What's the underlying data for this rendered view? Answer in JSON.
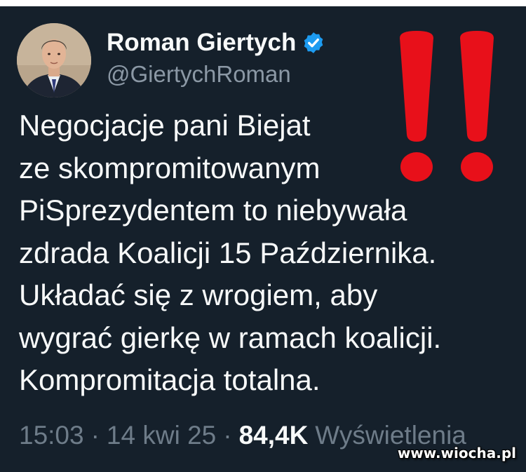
{
  "author": {
    "display_name": "Roman Giertych",
    "handle": "@GiertychRoman",
    "verified": true
  },
  "tweet": {
    "lines": [
      "Negocjacje pani Biejat",
      "ze skompromitowanym",
      "PiSprezydentem to niebywała",
      "zdrada Koalicji 15 Października.",
      "Układać się z wrogiem, aby",
      "wygrać gierkę w ramach koalicji.",
      "Kompromitacja totalna."
    ]
  },
  "meta": {
    "time": "15:03",
    "separator": "·",
    "date": "14 kwi 25",
    "views_count": "84,4K",
    "views_label": "Wyświetlenia"
  },
  "overlay": {
    "exclamation_icon": "double-exclamation-mark",
    "exclamation_color": "#e8101a"
  },
  "watermark": "www.wiocha.pl",
  "colors": {
    "background": "#15202b",
    "text": "#f7f9f9",
    "secondary": "#8b98a5",
    "verified": "#1d9bf0"
  }
}
